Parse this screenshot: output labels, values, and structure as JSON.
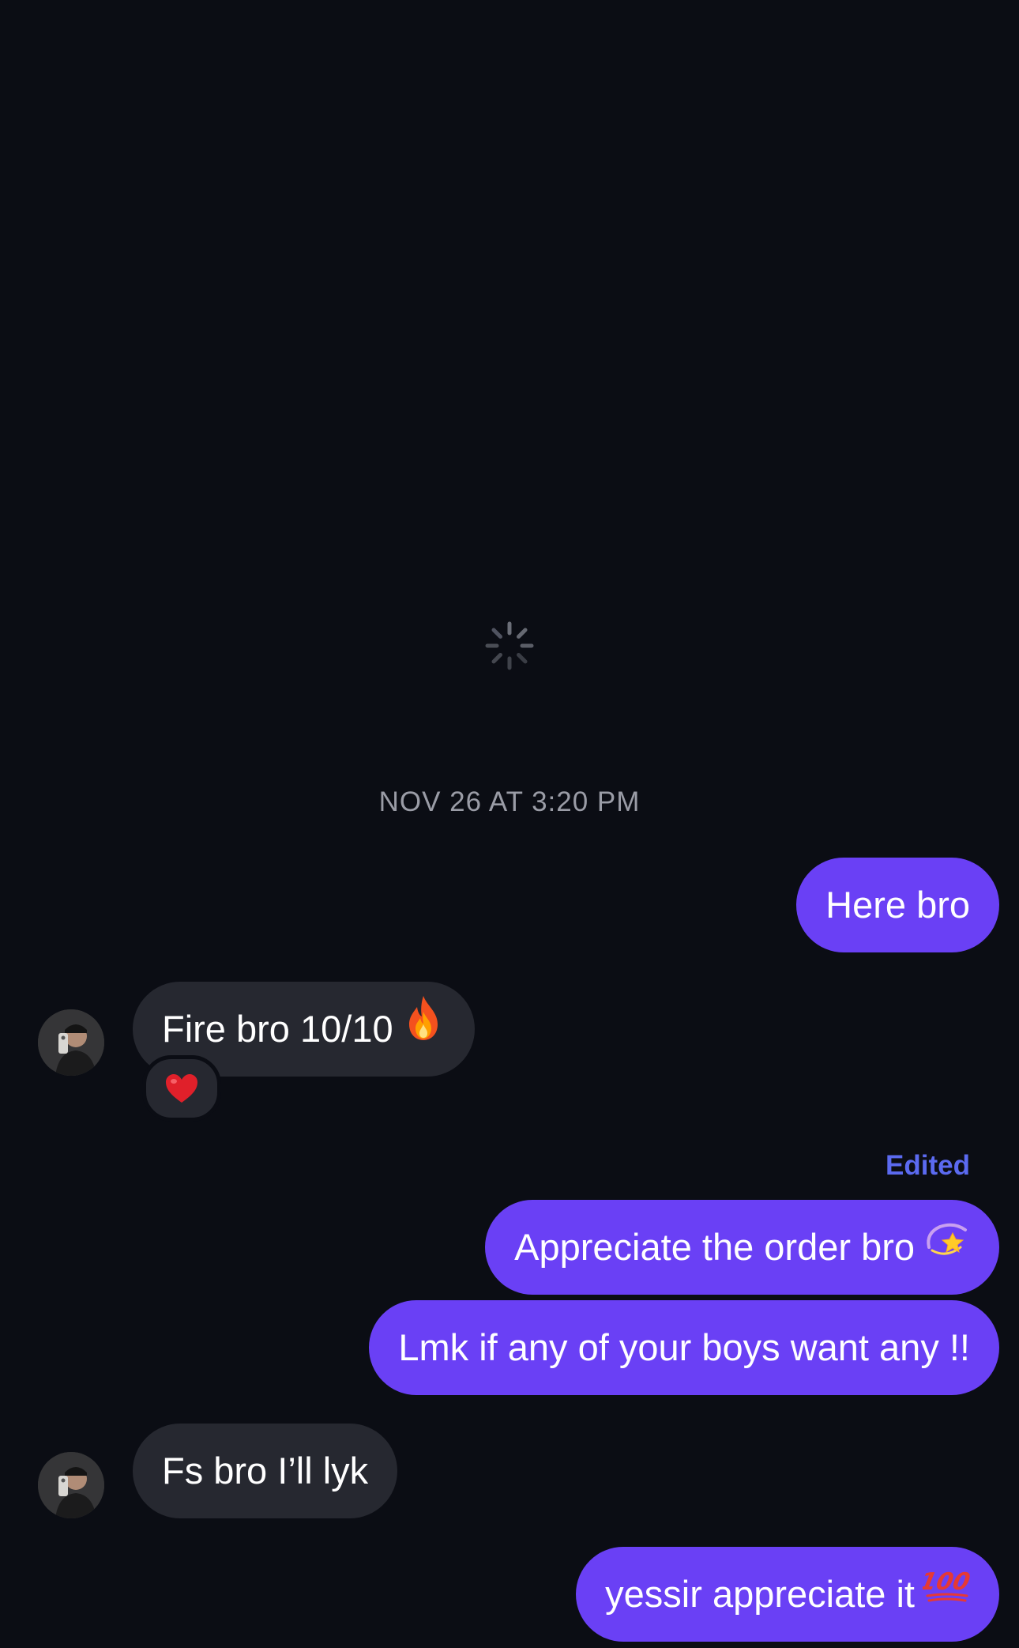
{
  "conversation": {
    "timestamp": "NOV 26 AT 3:20 PM",
    "messages": [
      {
        "id": "m1",
        "direction": "outgoing",
        "text": "Here bro"
      },
      {
        "id": "m2",
        "direction": "incoming",
        "text": "Fire bro 10/10",
        "emoji": "fire-icon",
        "reaction": "heart-icon"
      },
      {
        "id": "m3",
        "direction": "outgoing",
        "text": "Appreciate the order bro",
        "emoji": "dizzy-star-icon",
        "edited_label": "Edited"
      },
      {
        "id": "m4",
        "direction": "outgoing",
        "text": "Lmk if any of your boys want any !!"
      },
      {
        "id": "m5",
        "direction": "incoming",
        "text": "Fs bro I’ll lyk"
      },
      {
        "id": "m6",
        "direction": "outgoing",
        "text": "yessir appreciate it",
        "emoji": "hundred-points-icon"
      }
    ]
  },
  "colors": {
    "background": "#0b0d14",
    "outgoing_bubble": "#6a40f5",
    "incoming_bubble": "#262830",
    "edited_label": "#5b6af0",
    "timestamp": "#9a9ca6"
  }
}
